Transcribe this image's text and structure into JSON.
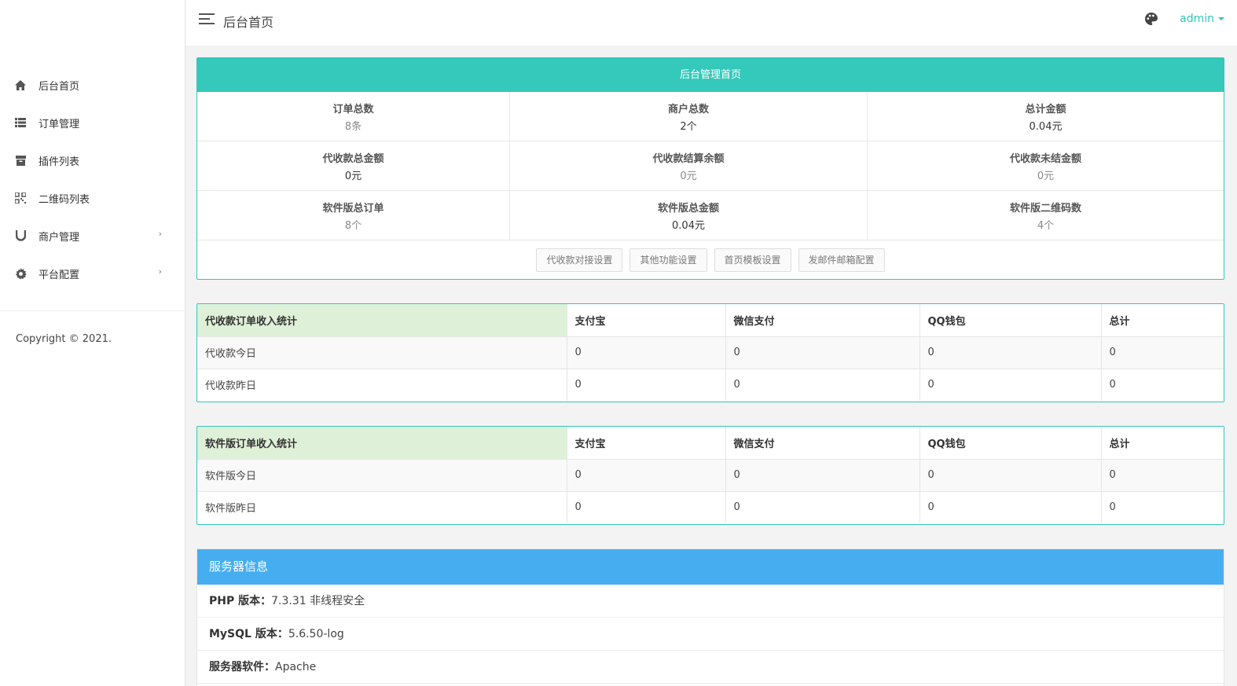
{
  "sidebar": {
    "items": [
      {
        "label": "后台首页",
        "icon": "home-icon",
        "has_arrow": false
      },
      {
        "label": "订单管理",
        "icon": "list-icon",
        "has_arrow": false
      },
      {
        "label": "插件列表",
        "icon": "box-icon",
        "has_arrow": false
      },
      {
        "label": "二维码列表",
        "icon": "qrcode-icon",
        "has_arrow": false
      },
      {
        "label": "商户管理",
        "icon": "magnet-icon",
        "has_arrow": true
      },
      {
        "label": "平台配置",
        "icon": "gear-icon",
        "has_arrow": true
      }
    ],
    "copyright": "Copyright © 2021."
  },
  "header": {
    "title": "后台首页",
    "user": "admin"
  },
  "dashboard": {
    "title": "后台管理首页",
    "stats": [
      {
        "label": "订单总数",
        "value": "8条"
      },
      {
        "label": "商户总数",
        "value": "2个"
      },
      {
        "label": "总计金额",
        "value": "0.04元"
      },
      {
        "label": "代收款总金额",
        "value": "0元"
      },
      {
        "label": "代收款结算余额",
        "value": "0元"
      },
      {
        "label": "代收款未结金额",
        "value": "0元"
      },
      {
        "label": "软件版总订单",
        "value": "8个"
      },
      {
        "label": "软件版总金额",
        "value": "0.04元"
      },
      {
        "label": "软件版二维码数",
        "value": "4个"
      }
    ],
    "buttons": [
      "代收款对接设置",
      "其他功能设置",
      "首页模板设置",
      "发邮件邮箱配置"
    ]
  },
  "table1": {
    "headers": [
      "代收款订单收入统计",
      "支付宝",
      "微信支付",
      "QQ钱包",
      "总计"
    ],
    "rows": [
      [
        "代收款今日",
        "0",
        "0",
        "0",
        "0"
      ],
      [
        "代收款昨日",
        "0",
        "0",
        "0",
        "0"
      ]
    ]
  },
  "table2": {
    "headers": [
      "软件版订单收入统计",
      "支付宝",
      "微信支付",
      "QQ钱包",
      "总计"
    ],
    "rows": [
      [
        "软件版今日",
        "0",
        "0",
        "0",
        "0"
      ],
      [
        "软件版昨日",
        "0",
        "0",
        "0",
        "0"
      ]
    ]
  },
  "server": {
    "title": "服务器信息",
    "rows": [
      {
        "key": "PHP 版本：",
        "value": "7.3.31 非线程安全"
      },
      {
        "key": "MySQL 版本：",
        "value": "5.6.50-log"
      },
      {
        "key": "服务器软件：",
        "value": "Apache"
      }
    ]
  },
  "colors": {
    "accent": "#32c5bb",
    "dash_header": "#35c9bb",
    "server_header": "#46aef0",
    "table_first_header": "#dff0d8"
  }
}
